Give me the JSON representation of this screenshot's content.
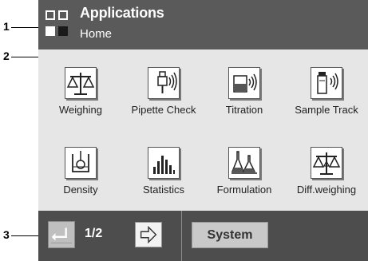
{
  "callouts": [
    "1",
    "2",
    "3"
  ],
  "header": {
    "title": "Applications",
    "subtitle": "Home"
  },
  "apps": [
    {
      "label": "Weighing",
      "icon": "balance-icon"
    },
    {
      "label": "Pipette Check",
      "icon": "pipette-icon"
    },
    {
      "label": "Titration",
      "icon": "titration-beaker-icon"
    },
    {
      "label": "Sample Track",
      "icon": "sample-vial-icon"
    },
    {
      "label": "Density",
      "icon": "density-beaker-icon"
    },
    {
      "label": "Statistics",
      "icon": "statistics-bars-icon"
    },
    {
      "label": "Formulation",
      "icon": "formulation-flasks-icon"
    },
    {
      "label": "Diff.weighing",
      "icon": "diff-balance-icon"
    }
  ],
  "footer": {
    "page_indicator": "1/2",
    "system_label": "System"
  },
  "colors": {
    "bars": "#4d4d4d",
    "screen_bg": "#e6e6e6"
  }
}
